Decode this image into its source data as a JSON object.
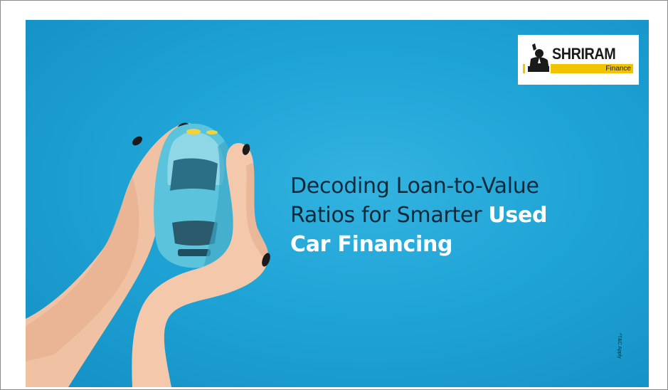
{
  "logo": {
    "name": "SHRIRAM",
    "sub": "Finance"
  },
  "headline": {
    "line1": "Decoding Loan-to-Value",
    "line2_plain": "Ratios for Smarter ",
    "line2_highlight": "Used",
    "line3_highlight": "Car Financing"
  },
  "disclaimer": "*T&C Apply",
  "colors": {
    "background": "#1fa4d6",
    "headline_text": "#0e2a3a",
    "highlight_text": "#ffffff",
    "logo_yellow": "#f2c400"
  },
  "illustration": "hands-holding-toy-car"
}
